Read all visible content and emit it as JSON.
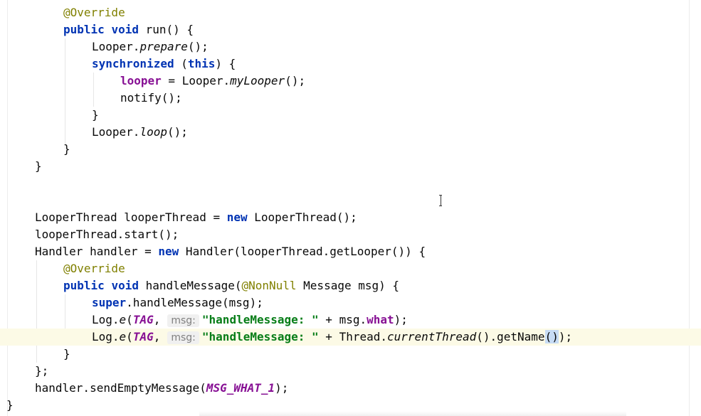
{
  "code": {
    "l1_annotation": "@Override",
    "l2_public": "public",
    "l2_void": "void",
    "l2_method": "run() {",
    "l3_call": "Looper.",
    "l3_method": "prepare",
    "l3_end": "();",
    "l4_sync": "synchronized",
    "l4_open": " (",
    "l4_this": "this",
    "l4_close": ") {",
    "l5_field": "looper",
    "l5_assign": " = Looper.",
    "l5_method": "myLooper",
    "l5_end": "();",
    "l6": "notify();",
    "l7": "}",
    "l8_call": "Looper.",
    "l8_method": "loop",
    "l8_end": "();",
    "l9": "}",
    "l10": "}",
    "l12_a": "LooperThread looperThread = ",
    "l12_new": "new",
    "l12_b": " LooperThread();",
    "l13": "looperThread.start();",
    "l14_a": "Handler handler = ",
    "l14_new": "new",
    "l14_b": " Handler(looperThread.getLooper()) {",
    "l15_annotation": "@Override",
    "l16_public": "public",
    "l16_void": "void",
    "l16_method": "handleMessage(",
    "l16_annotation": "@NonNull",
    "l16_end": " Message msg) {",
    "l17_super": "super",
    "l17_rest": ".handleMessage(msg);",
    "l18_a": "Log.",
    "l18_e": "e",
    "l18_open": "(",
    "l18_tag": "TAG",
    "l18_comma": ",",
    "l18_hint": "msg:",
    "l18_str": "\"handleMessage: \"",
    "l18_b": " + msg.",
    "l18_what": "what",
    "l18_end": ");",
    "l19_a": "Log.",
    "l19_e": "e",
    "l19_open": "(",
    "l19_tag": "TAG",
    "l19_comma": ",",
    "l19_hint": "msg:",
    "l19_str": "\"handleMessage: \"",
    "l19_b": " + Thread.",
    "l19_current": "currentThread",
    "l19_c": "().getName",
    "l19_parens": "()",
    "l19_end": ");",
    "l20": "}",
    "l21": "};",
    "l22_a": "handler.sendEmptyMessage(",
    "l22_const": "MSG_WHAT_1",
    "l22_end": ");",
    "l23": "}"
  },
  "colors": {
    "keyword": "#0033b3",
    "annotation": "#808000",
    "field": "#871094",
    "string": "#067d17",
    "current_line": "#fcfae6"
  }
}
